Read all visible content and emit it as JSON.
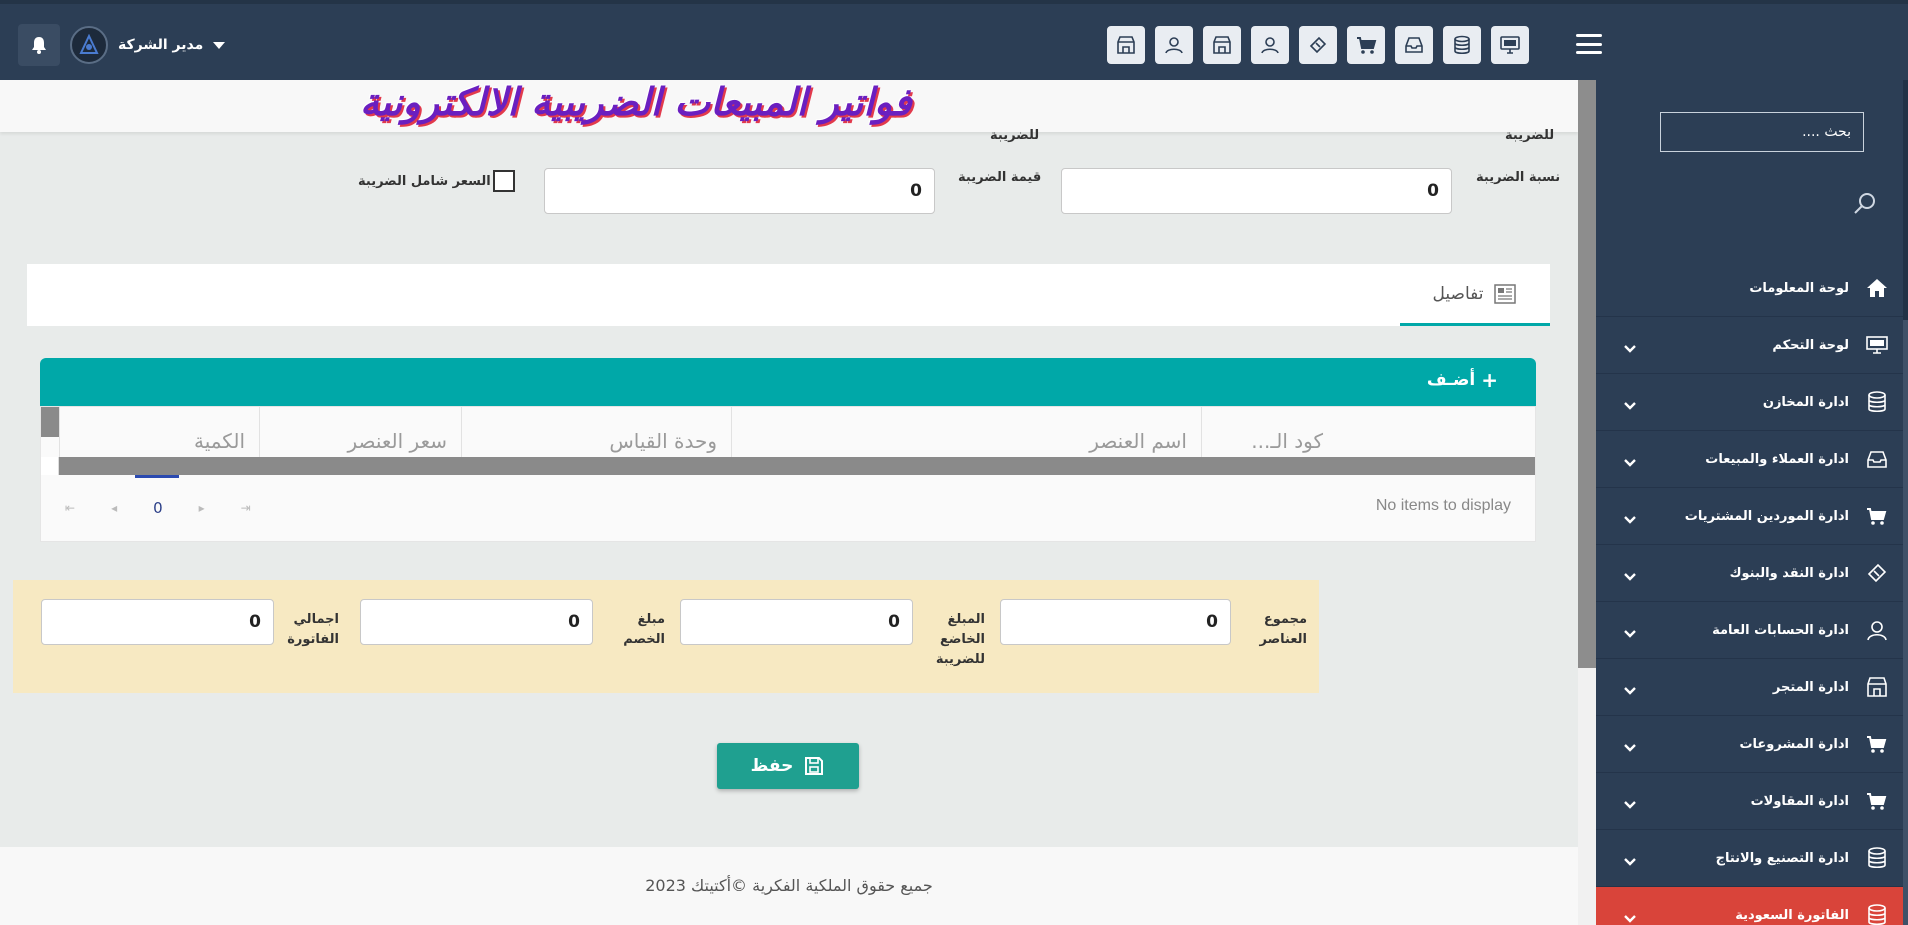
{
  "topbar": {
    "user_name": "مدير الشركة",
    "icons": [
      "monitor-icon",
      "database-icon",
      "inbox-icon",
      "cart-icon",
      "ticket-icon",
      "user-icon",
      "store-icon",
      "user-icon",
      "store-icon"
    ]
  },
  "sidebar": {
    "search_placeholder": "بحث ....",
    "items": [
      {
        "label": "لوحة المعلومات",
        "icon": "home-icon",
        "has_chevron": false
      },
      {
        "label": "لوحة التحكم",
        "icon": "monitor-icon",
        "has_chevron": true
      },
      {
        "label": "ادارة المخازن",
        "icon": "database-icon",
        "has_chevron": true
      },
      {
        "label": "ادارة العملاء والمبيعات",
        "icon": "inbox-icon",
        "has_chevron": true
      },
      {
        "label": "ادارة الموردين المشتريات",
        "icon": "cart-icon",
        "has_chevron": true
      },
      {
        "label": "ادارة النقد والبنوك",
        "icon": "ticket-icon",
        "has_chevron": true
      },
      {
        "label": "ادارة الحسابات العامة",
        "icon": "user-icon",
        "has_chevron": true
      },
      {
        "label": "ادارة المتجر",
        "icon": "store-icon",
        "has_chevron": true
      },
      {
        "label": "ادارة المشروعات",
        "icon": "cart-icon",
        "has_chevron": true
      },
      {
        "label": "ادارة المقاولات",
        "icon": "cart-icon",
        "has_chevron": true
      },
      {
        "label": "ادارة التصنيع والانتاج",
        "icon": "database-icon",
        "has_chevron": true
      },
      {
        "label": "الفاتورة السعودية",
        "icon": "database-icon",
        "has_chevron": true,
        "active": true
      }
    ]
  },
  "page": {
    "title": "فواتير المبيعات الضريبية الالكترونية",
    "clipped_label_1": "للضريبة",
    "clipped_label_2": "للضريبة"
  },
  "tax": {
    "rate_label": "نسبة الضريبة",
    "rate_value": "0",
    "amount_label": "قيمة الضريبة",
    "amount_value": "0",
    "inclusive_label": "السعر شامل الضريبة"
  },
  "tabs": {
    "details_label": "تفاصيل"
  },
  "grid": {
    "add_label": "أضـف",
    "columns": [
      "كود الـ...",
      "اسم العنصر",
      "وحدة القياس",
      "سعر العنصر",
      "الكمية"
    ],
    "page_number": "0",
    "empty_message": "No items to display"
  },
  "totals": {
    "items_total_label": "مجموع العناصر",
    "items_total_value": "0",
    "taxable_label": "المبلغ الخاضع للضريبة",
    "taxable_value": "0",
    "discount_label": "مبلغ الخصم",
    "discount_value": "0",
    "invoice_total_label": "اجمالي الفاتورة",
    "invoice_total_value": "0"
  },
  "actions": {
    "save_label": "حفظ"
  },
  "footer": {
    "copyright": "جميع حقوق الملكية الفكرية ©أكتيتك 2023"
  },
  "colors": {
    "navy": "#2c3e55",
    "teal": "#00a8a8",
    "save_green": "#1fa090",
    "active_red": "#d9443a",
    "totals_bg": "#f7e9c2"
  }
}
